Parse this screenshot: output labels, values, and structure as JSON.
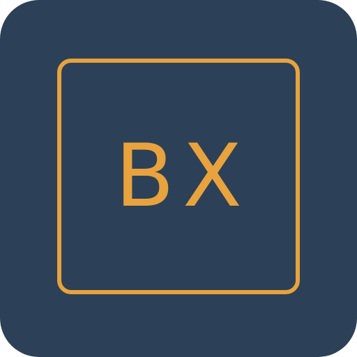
{
  "icon": {
    "monogram": "BX"
  },
  "colors": {
    "background": "#2c4157",
    "accent": "#e8a23e"
  }
}
